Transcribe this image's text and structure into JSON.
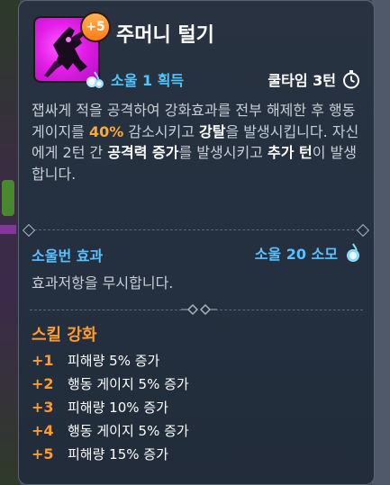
{
  "skill": {
    "name": "주머니 털기",
    "enhance_level": "+5",
    "soul_gain": "소울 1 획득",
    "cooldown": "쿨타임 3턴",
    "description": {
      "p1": "잽싸게 적을 공격하여 강화효과를 전부 해제한 후 행동 게이지를 ",
      "p2": "40%",
      "p3": " 감소시키고 ",
      "p4": "강탈",
      "p5": "을 발생시킵니다. 자신에게 2턴 간 ",
      "p6": "공격력 증가",
      "p7": "를 발생시키고 ",
      "p8": "추가 턴",
      "p9": "이 발생합니다."
    }
  },
  "soulburn": {
    "label": "소울번 효과",
    "cost": "소울 20 소모",
    "effect": "효과저항을 무시합니다."
  },
  "enhancements": {
    "title": "스킬 강화",
    "items": [
      {
        "level": "+1",
        "effect": "피해량 5% 증가"
      },
      {
        "level": "+2",
        "effect": "행동 게이지 5% 증가"
      },
      {
        "level": "+3",
        "effect": "피해량 10% 증가"
      },
      {
        "level": "+4",
        "effect": "행동 게이지 5% 증가"
      },
      {
        "level": "+5",
        "effect": "피해량 15% 증가"
      }
    ]
  },
  "colors": {
    "soul": "#4fc6ff",
    "highlight": "#ffa834",
    "enhance": "#ff9b2e",
    "icon_bg": "#e41ee8"
  },
  "icons": {
    "skill": "skill-icon",
    "soul": "soul-orb-icon",
    "cooldown": "stopwatch-icon"
  }
}
